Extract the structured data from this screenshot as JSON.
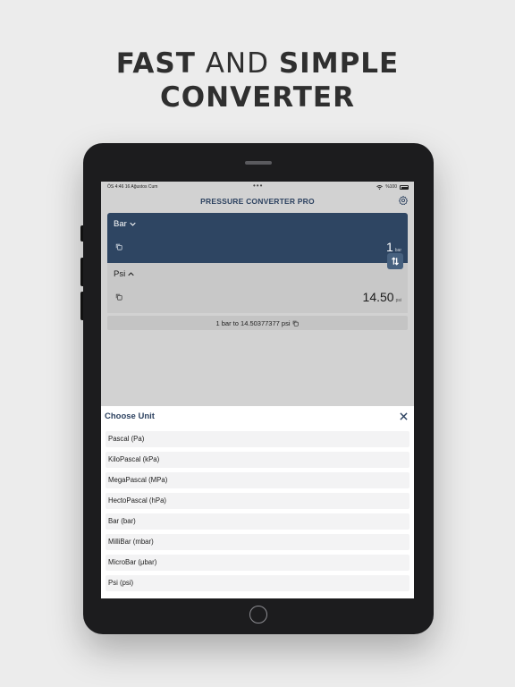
{
  "headline": {
    "line1_bold": "FAST",
    "line1_light": "AND",
    "line1_bold2": "SIMPLE",
    "line2": "CONVERTER"
  },
  "statusbar": {
    "time_date": "ÖS 4:46   16 Ağustos Cum",
    "battery": "%100"
  },
  "app": {
    "title": "PRESSURE CONVERTER PRO",
    "from": {
      "unit": "Bar",
      "value": "1",
      "unit_short": "bar"
    },
    "to": {
      "unit": "Psi",
      "value": "14.50",
      "unit_short": "psi"
    },
    "result": "1 bar to 14.50377377 psi"
  },
  "sheet": {
    "title": "Choose Unit",
    "units": [
      "Pascal (Pa)",
      "KiloPascal (kPa)",
      "MegaPascal (MPa)",
      "HectoPascal (hPa)",
      "Bar (bar)",
      "MilliBar (mbar)",
      "MicroBar (μbar)",
      "Psi (psi)"
    ]
  },
  "colors": {
    "accent": "#2e4562",
    "title": "#2d4260",
    "background": "#ececec"
  },
  "icons": [
    "gear-icon",
    "chevron-down-icon",
    "chevron-up-icon",
    "copy-icon",
    "swap-icon",
    "close-icon",
    "wifi-icon",
    "battery-icon"
  ]
}
